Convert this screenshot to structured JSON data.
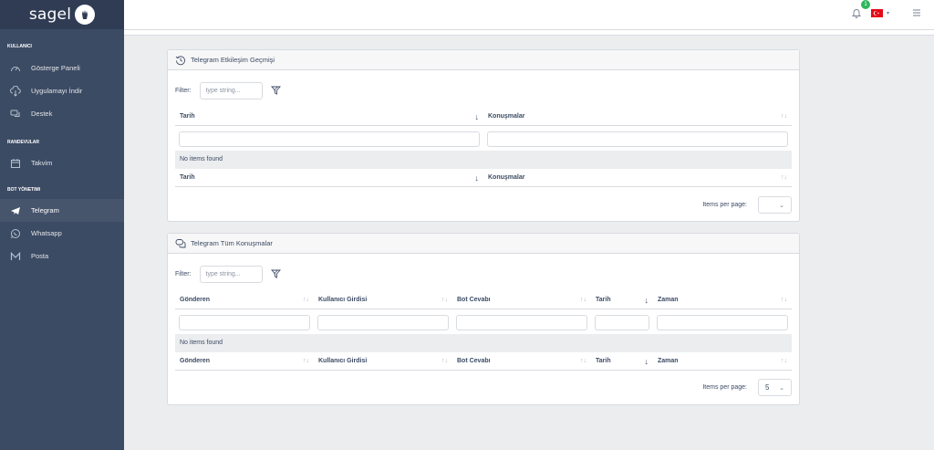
{
  "brand": {
    "name": "sagel"
  },
  "sidebar": {
    "sections": [
      {
        "title": "KULLANICI",
        "items": [
          {
            "label": "Gösterge Paneli",
            "icon": "speedometer-icon"
          },
          {
            "label": "Uygulamayı İndir",
            "icon": "cloud-download-icon"
          },
          {
            "label": "Destek",
            "icon": "chat-icon"
          }
        ]
      },
      {
        "title": "RANDEVULAR",
        "items": [
          {
            "label": "Takvim",
            "icon": "calendar-icon"
          }
        ]
      },
      {
        "title": "BOT YÖNETIMI",
        "items": [
          {
            "label": "Telegram",
            "icon": "telegram-icon",
            "active": true
          },
          {
            "label": "Whatsapp",
            "icon": "whatsapp-icon"
          },
          {
            "label": "Posta",
            "icon": "mail-icon"
          }
        ]
      }
    ]
  },
  "header": {
    "notification_count": "1",
    "language_flag": "tr-flag-icon"
  },
  "card1": {
    "title": "Telegram Etkileşim Geçmişi",
    "filter_label": "Filter:",
    "filter_placeholder": "type string...",
    "columns": [
      "Tarih",
      "Konuşmalar"
    ],
    "empty_text": "No items found",
    "pager_label": "Items per page:",
    "pager_value": ""
  },
  "card2": {
    "title": "Telegram Tüm Konuşmalar",
    "filter_label": "Filter:",
    "filter_placeholder": "type string...",
    "columns": [
      "Gönderen",
      "Kullanıcı Girdisi",
      "Bot Cevabı",
      "Tarih",
      "Zaman"
    ],
    "empty_text": "No items found",
    "pager_label": "Items per page:",
    "pager_value": "5"
  },
  "colors": {
    "sidebar": "#3c4b64",
    "brand": "#303c54",
    "badge": "#2eb85c",
    "flag": "#e30a17"
  }
}
